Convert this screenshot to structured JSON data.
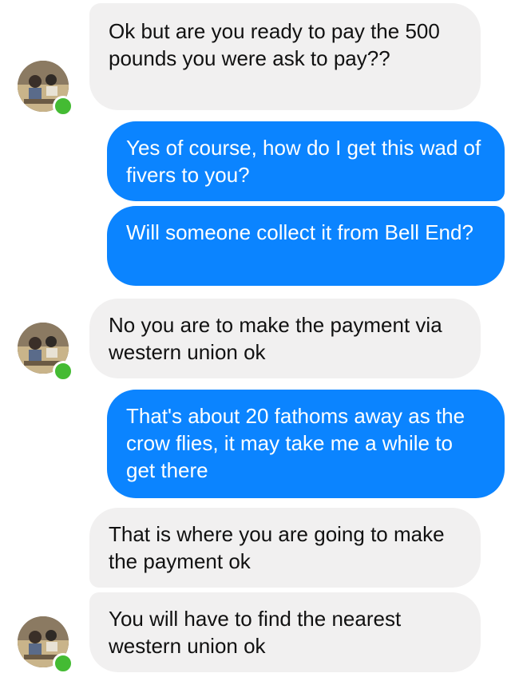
{
  "colors": {
    "incoming_bubble": "#f1f0f0",
    "outgoing_bubble": "#0b84ff",
    "online_dot": "#44bb33"
  },
  "messages": [
    {
      "sender": "them",
      "text": "Ok but are you ready to pay the 500 pounds you were ask to pay??"
    },
    {
      "sender": "me",
      "text": "Yes of course, how do I get this wad of fivers to you?"
    },
    {
      "sender": "me",
      "text": "Will someone collect it from Bell End?"
    },
    {
      "sender": "them",
      "text": "No you are to make the payment via western union ok"
    },
    {
      "sender": "me",
      "text": "That's about 20 fathoms away as the crow flies, it may take me a while to get there"
    },
    {
      "sender": "them",
      "text": "That is where you are going to make the payment ok"
    },
    {
      "sender": "them",
      "text": "You will have to find the nearest western union ok"
    }
  ],
  "contact": {
    "avatar_icon": "profile-photo-icon",
    "status_icon": "online-status-icon"
  }
}
